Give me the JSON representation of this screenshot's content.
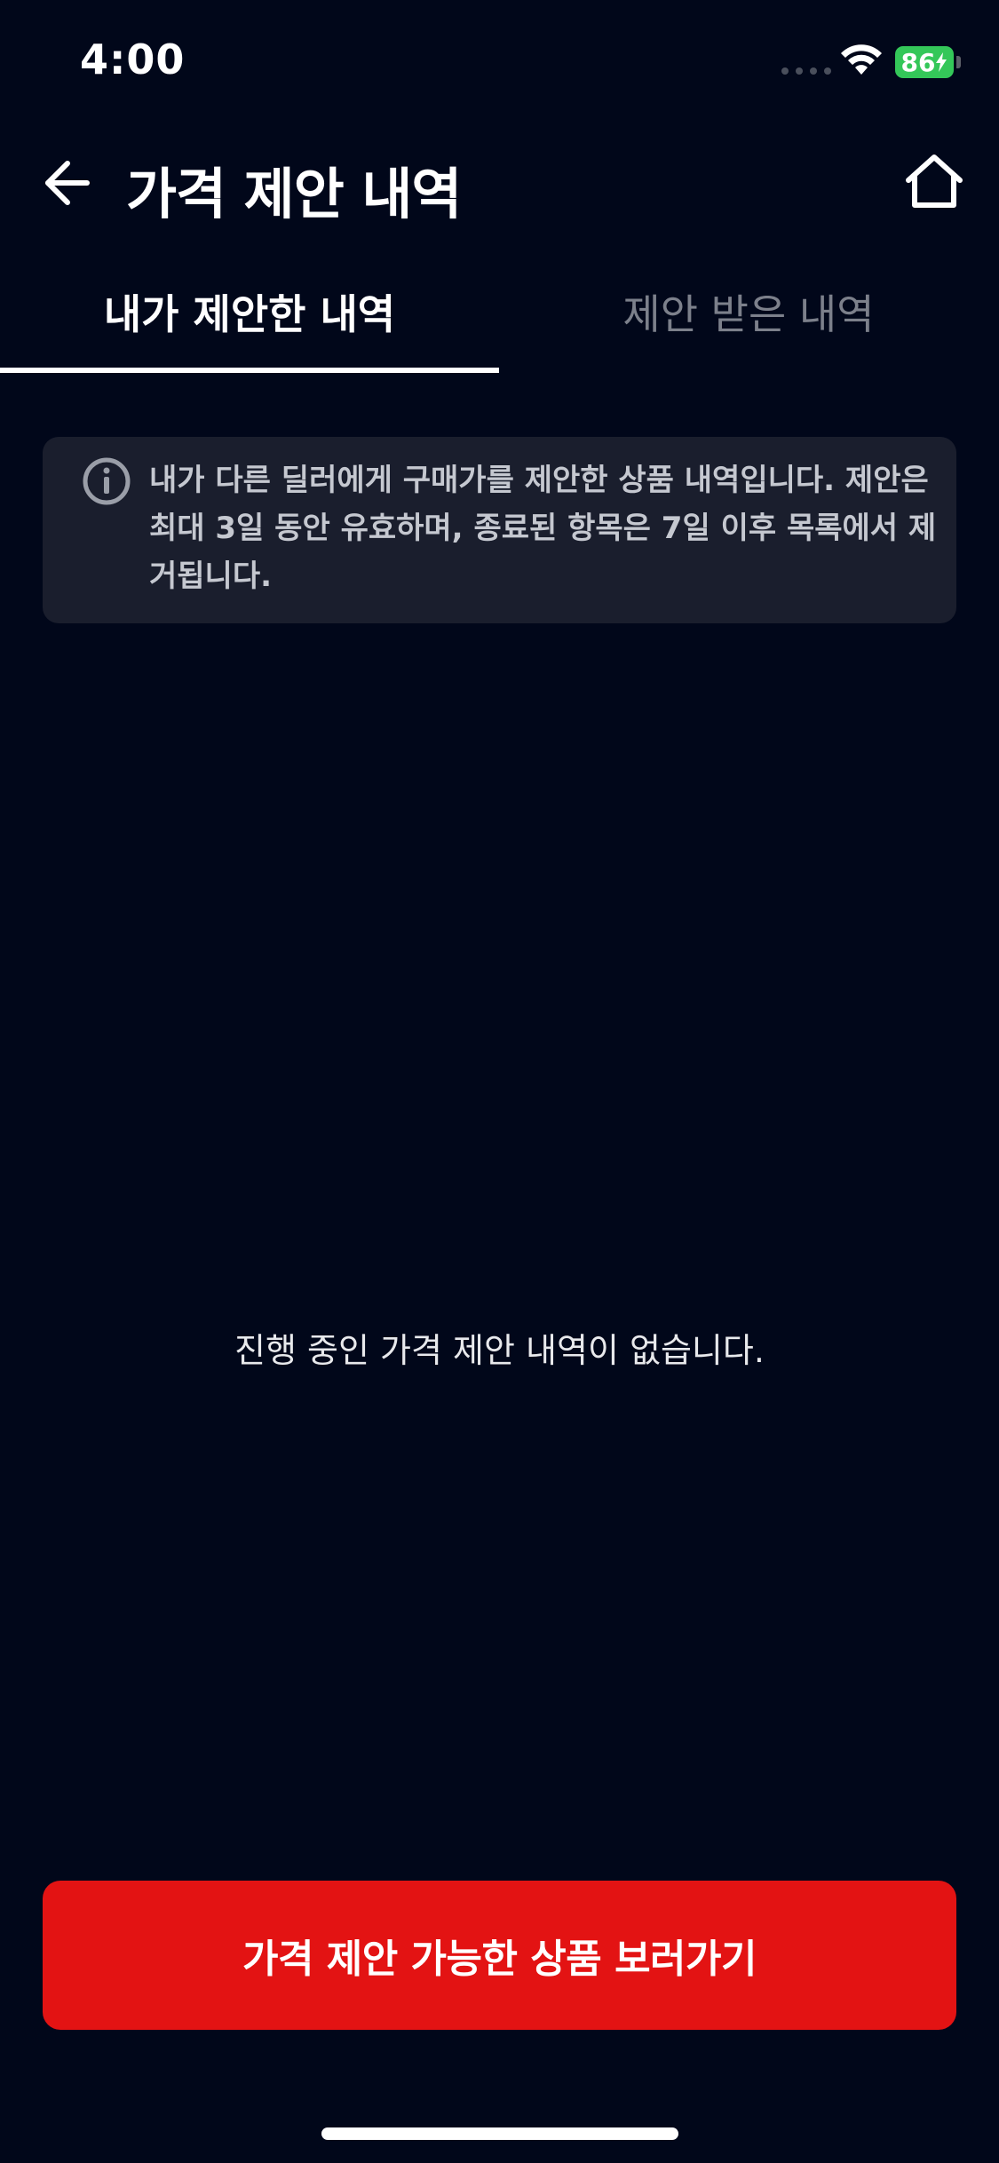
{
  "status_bar": {
    "time": "4:00",
    "battery": "86"
  },
  "header": {
    "title": "가격 제안 내역",
    "back_icon": "arrow-left-icon",
    "home_icon": "home-icon"
  },
  "tabs": [
    {
      "label": "내가 제안한 내역",
      "active": true
    },
    {
      "label": "제안 받은 내역",
      "active": false
    }
  ],
  "info": {
    "icon": "info-circle-icon",
    "text": "내가 다른 딜러에게 구매가를 제안한 상품 내역입니다. 제안은 최대 3일 동안 유효하며, 종료된 항목은 7일 이후 목록에서 제거됩니다."
  },
  "empty_state": {
    "message": "진행 중인 가격 제안 내역이 없습니다."
  },
  "cta": {
    "label": "가격 제안 가능한 상품 보러가기"
  },
  "colors": {
    "background": "#01071A",
    "info_box": "#1A1E2D",
    "cta": "#E31313",
    "battery": "#34C759",
    "inactive_tab": "#7C808B"
  }
}
